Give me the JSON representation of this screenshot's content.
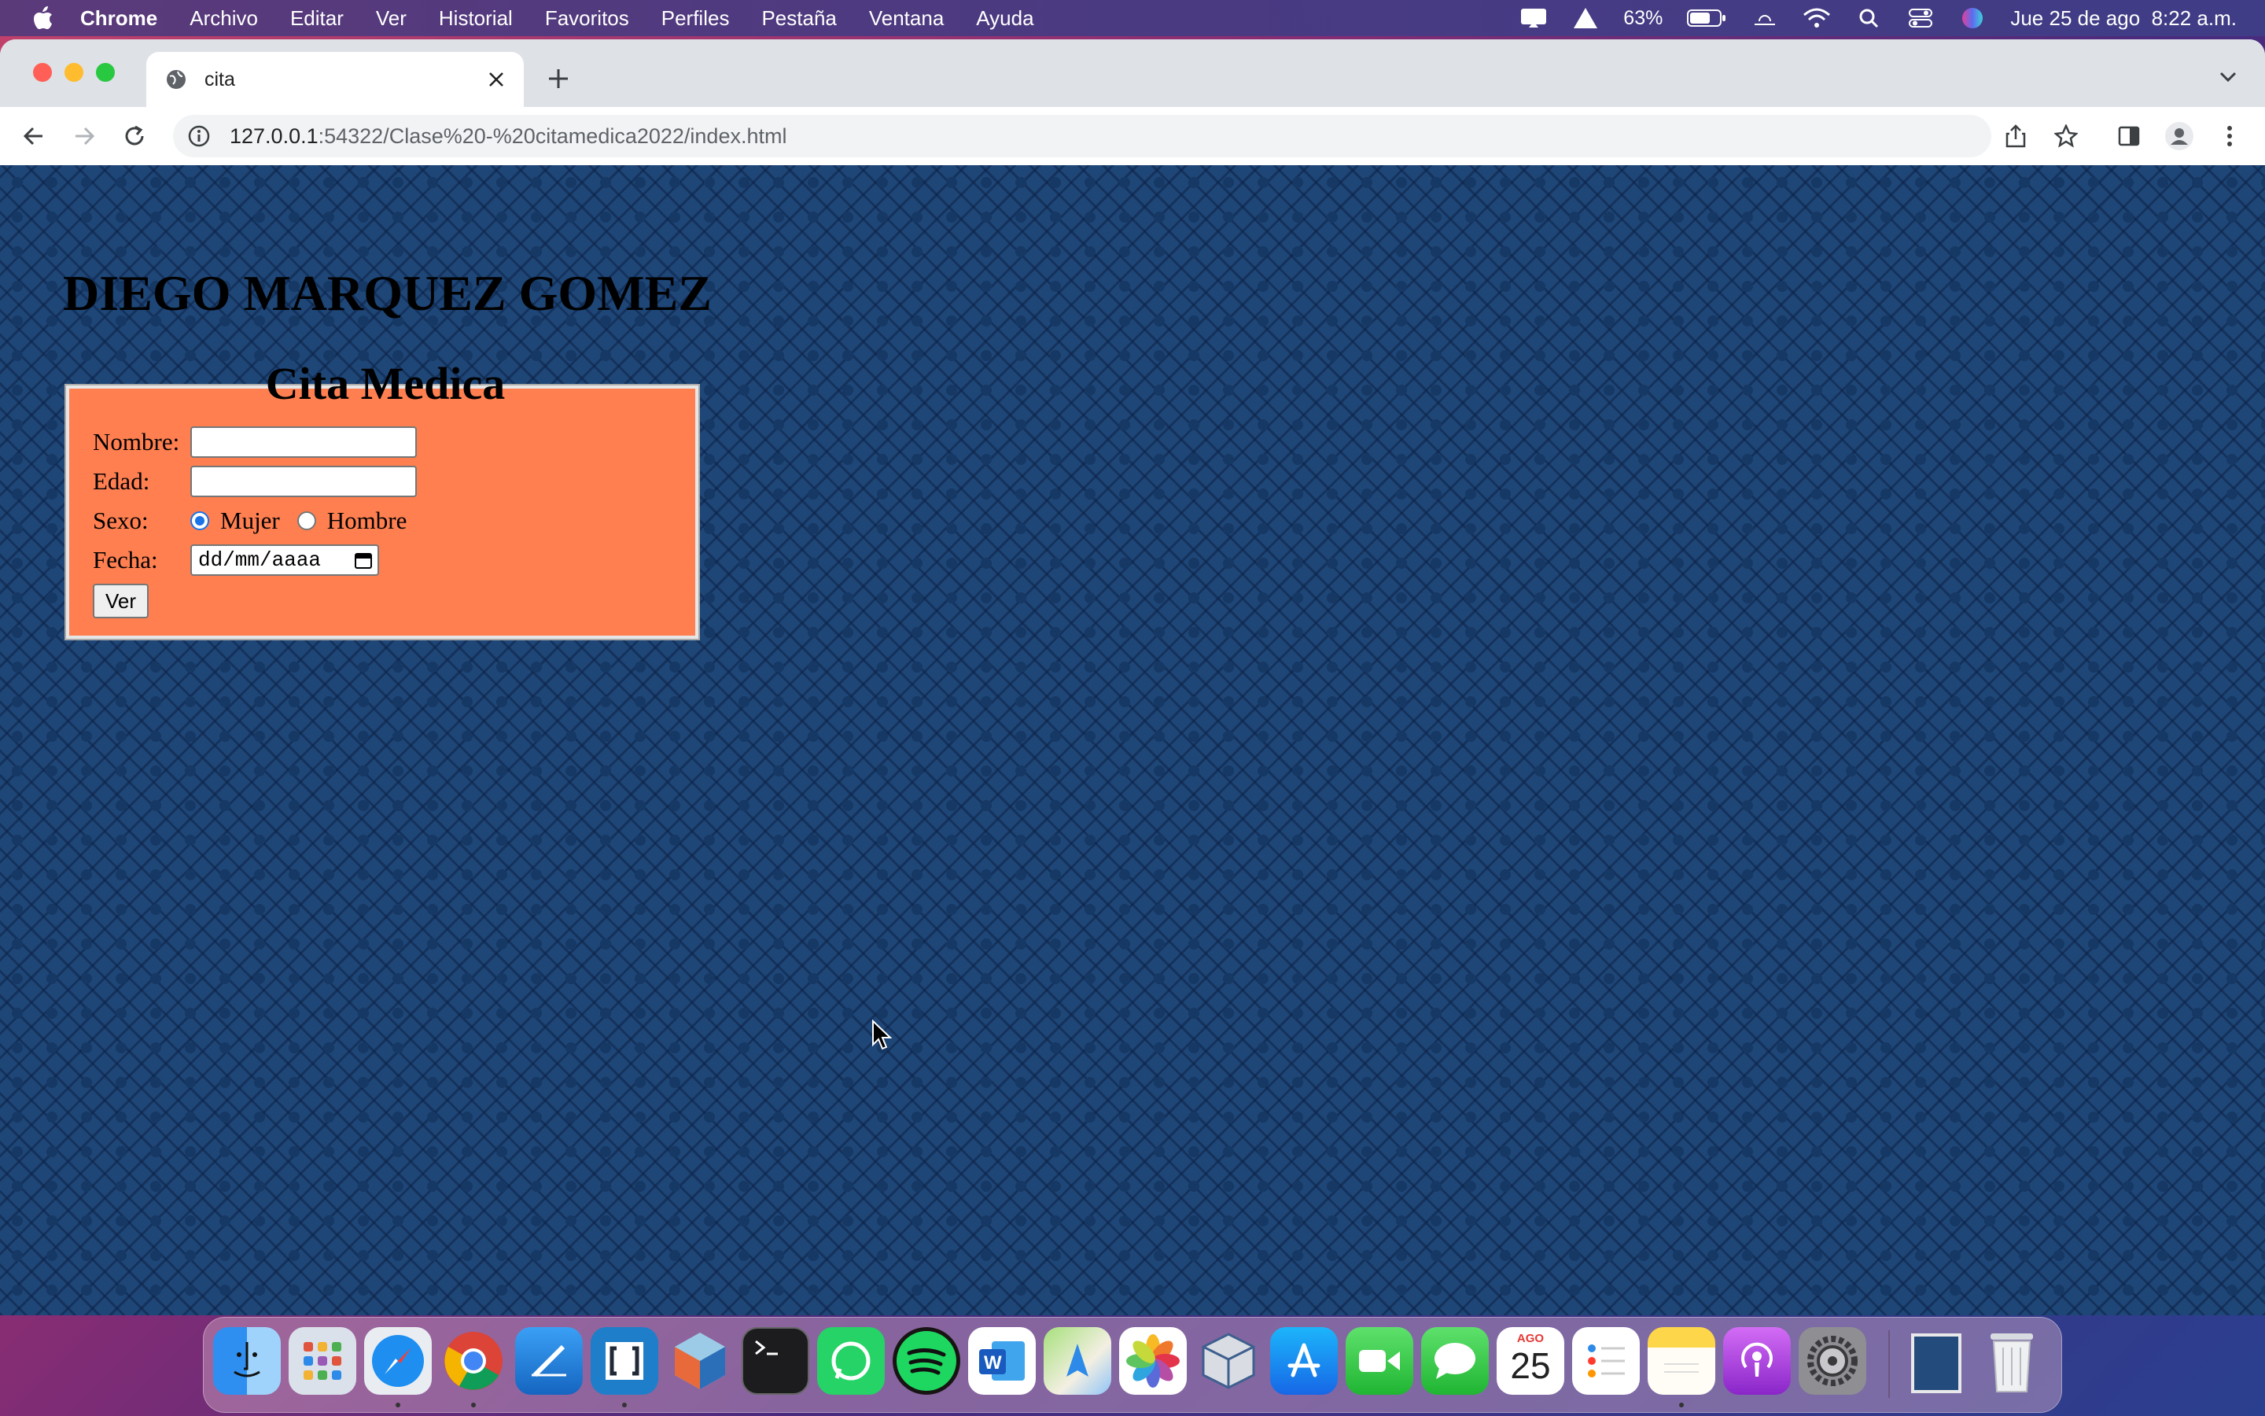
{
  "menubar": {
    "app_name": "Chrome",
    "items": [
      "Archivo",
      "Editar",
      "Ver",
      "Historial",
      "Favoritos",
      "Perfiles",
      "Pestaña",
      "Ventana",
      "Ayuda"
    ],
    "battery_percent": "63%",
    "datetime": "Jue 25 de ago  8:22 a.m."
  },
  "browser": {
    "tab_title": "cita",
    "url_host": "127.0.0.1",
    "url_rest": ":54322/Clase%20-%20citamedica2022/index.html"
  },
  "page": {
    "heading": "DIEGO MARQUEZ GOMEZ",
    "form_title": "Cita Medica",
    "nombre_label": "Nombre:",
    "nombre_value": "",
    "edad_label": "Edad:",
    "edad_value": "",
    "sexo_label": "Sexo:",
    "sexo_options": [
      "Mujer",
      "Hombre"
    ],
    "sexo_selected": "Mujer",
    "fecha_label": "Fecha:",
    "fecha_placeholder": "dd/mm/aaaa",
    "submit_label": "Ver"
  },
  "dock": {
    "calendar_month": "AGO",
    "calendar_day": "25",
    "apps": [
      "finder",
      "launchpad",
      "safari",
      "chrome",
      "xcode",
      "brackets",
      "netbeans",
      "terminal",
      "whatsapp",
      "spotify",
      "word",
      "maps",
      "photos",
      "virtualbox",
      "app-store",
      "facetime",
      "messages",
      "calendar",
      "reminders",
      "notes",
      "podcasts",
      "system-preferences",
      "downloads-folder",
      "trash"
    ]
  },
  "colors": {
    "form_background": "#ff7f50",
    "page_background": "#1e4677"
  }
}
